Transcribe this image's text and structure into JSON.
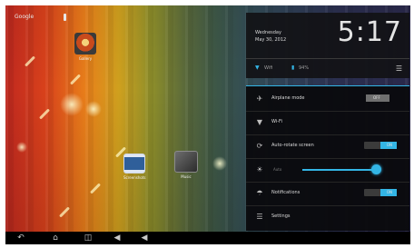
{
  "statusbar": {
    "label": "Google"
  },
  "desktop": {
    "icons": [
      {
        "name": "app-icon-top",
        "caption": "Gallery"
      },
      {
        "name": "app-icon-left",
        "caption": "Screenshots"
      },
      {
        "name": "app-icon-right",
        "caption": "Music"
      }
    ]
  },
  "notification": {
    "weekday": "Wednesday",
    "date": "May 30, 2012",
    "time": "5:17",
    "wifi_label": "Wifi",
    "battery_label": "94%"
  },
  "quick_settings": {
    "rows": [
      {
        "label": "Airplane mode",
        "state": "OFF"
      },
      {
        "label": "Wi-Fi"
      },
      {
        "label": "Auto-rotate screen",
        "state": "ON"
      },
      {
        "label": "Brightness",
        "slider_label": "Auto"
      },
      {
        "label": "Notifications",
        "state": "ON"
      },
      {
        "label": "Settings"
      }
    ]
  },
  "navbar": {
    "buttons": [
      "back",
      "home",
      "recent",
      "volume-down",
      "volume-up"
    ]
  },
  "colors": {
    "accent": "#33b5e5",
    "panel": "#0a0a0e"
  }
}
